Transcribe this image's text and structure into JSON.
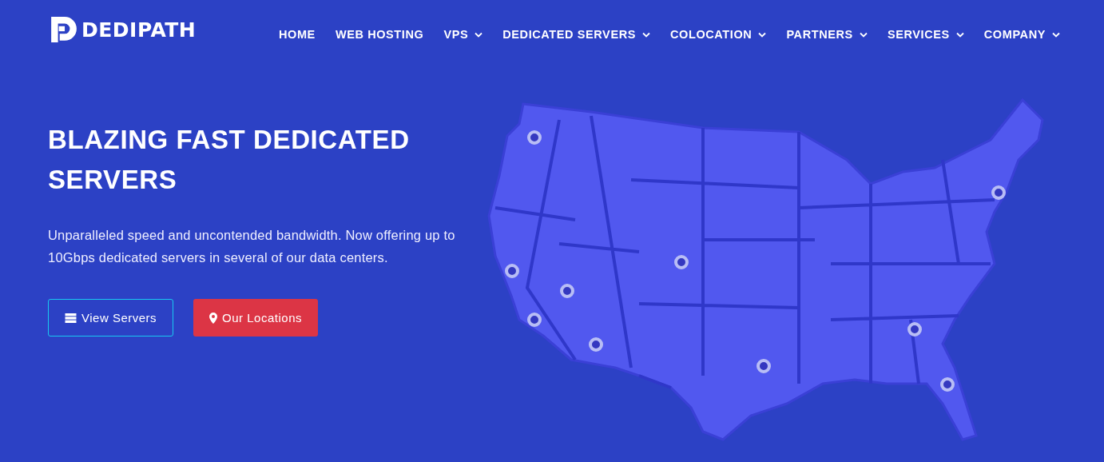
{
  "logo": {
    "text": "DEDIPATH"
  },
  "nav": [
    {
      "label": "HOME",
      "has_dropdown": false
    },
    {
      "label": "WEB HOSTING",
      "has_dropdown": false
    },
    {
      "label": "VPS",
      "has_dropdown": true
    },
    {
      "label": "DEDICATED SERVERS",
      "has_dropdown": true
    },
    {
      "label": "COLOCATION",
      "has_dropdown": true
    },
    {
      "label": "PARTNERS",
      "has_dropdown": true
    },
    {
      "label": "SERVICES",
      "has_dropdown": true
    },
    {
      "label": "COMPANY",
      "has_dropdown": true
    }
  ],
  "hero": {
    "title": "BLAZING FAST DEDICATED SERVERS",
    "text": "Unparalleled speed and uncontended bandwidth. Now offering up to 10Gbps dedicated servers in several of our data centers.",
    "buttons": [
      {
        "label": "View Servers",
        "kind": "outline"
      },
      {
        "label": "Our Locations",
        "kind": "filled"
      }
    ]
  }
}
